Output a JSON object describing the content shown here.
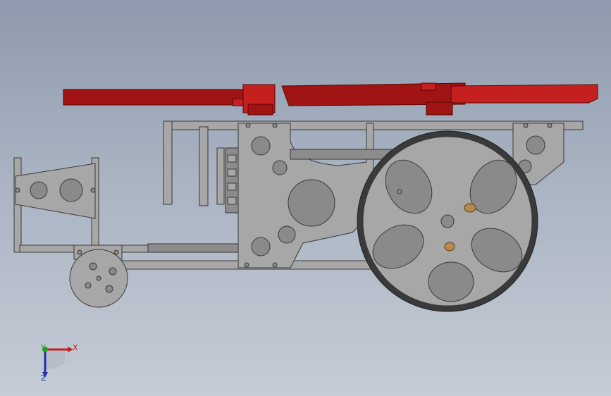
{
  "viewport": {
    "background_top": "#8e9aad",
    "background_bottom": "#c6ccd6"
  },
  "model": {
    "part_color": "#a7a7a7",
    "accent_color": "#a01414",
    "tire_color": "#3a3a3a"
  },
  "triad": {
    "x_label": "X",
    "y_label": "Y",
    "z_label": "Z",
    "x_color": "#c02020",
    "y_color": "#20a020",
    "z_color": "#2030b0"
  }
}
